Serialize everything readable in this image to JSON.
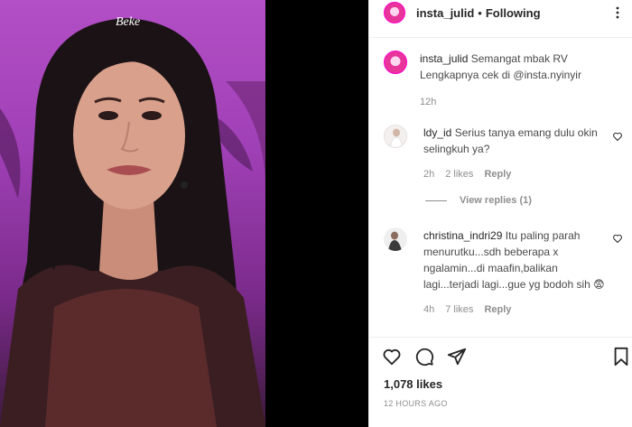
{
  "post": {
    "username": "insta_julid",
    "separator": "•",
    "follow_state": "Following",
    "caption_user": "insta_julid",
    "caption_text": "Semangat mbak RV Lengkapnya cek di @insta.nyinyir",
    "caption_time": "12h",
    "likes": "1,078 likes",
    "posted_time": "12 HOURS AGO"
  },
  "photo": {
    "watermark": "Beke"
  },
  "comments": [
    {
      "user": "ldy_id",
      "text": "Serius tanya emang dulu okin selingkuh ya?",
      "time": "2h",
      "likes": "2 likes",
      "reply": "Reply"
    },
    {
      "user": "christina_indri29",
      "text": "Itu paling parah menurutku...sdh beberapa x ngalamin...di maafin,balikan lagi...terjadi lagi...gue yg bodoh sih 😨",
      "time": "4h",
      "likes": "7 likes",
      "reply": "Reply"
    }
  ],
  "view_replies": "View replies (1)",
  "icons": [
    "more-icon",
    "heart-icon",
    "comment-icon",
    "share-icon",
    "bookmark-icon"
  ]
}
